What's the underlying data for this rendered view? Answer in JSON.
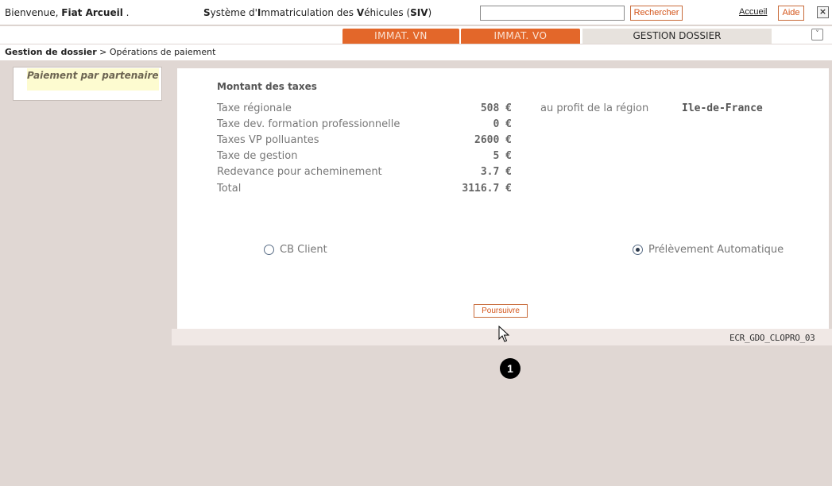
{
  "header": {
    "welcome_prefix": "Bienvenue, ",
    "user_name": "Fiat Arcueil",
    "welcome_suffix": " .",
    "system_title": {
      "s": "S",
      "part1": "ystème d'",
      "i": "I",
      "part2": "mmatriculation des ",
      "v": "V",
      "part3": "éhicules (",
      "acronym": "SIV",
      "part4": ")"
    },
    "search_value": "",
    "search_button": "Rechercher",
    "home_link": "Accueil",
    "help_button": "Aide",
    "close_symbol": "×"
  },
  "tabs": [
    {
      "label": "IMMAT. VN",
      "active": false
    },
    {
      "label": "IMMAT. VO",
      "active": false
    },
    {
      "label": "GESTION DOSSIER",
      "active": true
    }
  ],
  "collapse_symbol": "˅",
  "breadcrumb": {
    "section": "Gestion de dossier",
    "separator": " > ",
    "page": "Opérations de paiement"
  },
  "side_menu": {
    "item": "Paiement par partenaire"
  },
  "taxes": {
    "heading": "Montant des taxes",
    "rows": [
      {
        "label": "Taxe régionale",
        "amount": "508 €"
      },
      {
        "label": "Taxe dev. formation professionnelle",
        "amount": "0 €"
      },
      {
        "label": "Taxes VP polluantes",
        "amount": "2600 €"
      },
      {
        "label": "Taxe de gestion",
        "amount": "5 €"
      },
      {
        "label": "Redevance pour acheminement",
        "amount": "3.7 €"
      },
      {
        "label": "Total",
        "amount": "3116.7 €"
      }
    ],
    "region_label": "au profit de la région",
    "region_name": "Ile-de-France"
  },
  "payment_options": [
    {
      "label": "CB Client",
      "selected": false
    },
    {
      "label": "Prélèvement Automatique",
      "selected": true
    }
  ],
  "continue_button": "Poursuivre",
  "screen_code": "ECR_GDO_CLOPRO_03",
  "step_marker": "1",
  "colors": {
    "accent_orange": "#e3672a",
    "page_background": "#e0d7d3",
    "button_border": "#c86b3a"
  }
}
